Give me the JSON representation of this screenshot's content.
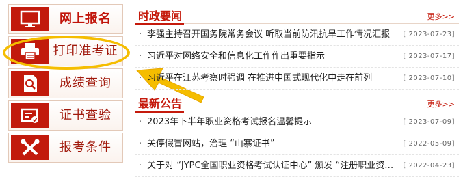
{
  "nav": {
    "items": [
      {
        "label": "网上报名",
        "icon": "monitor-icon"
      },
      {
        "label": "打印准考证",
        "icon": "printer-icon"
      },
      {
        "label": "成绩查询",
        "icon": "document-search-icon"
      },
      {
        "label": "证书查验",
        "icon": "certificate-check-icon"
      },
      {
        "label": "报考条件",
        "icon": "tools-icon"
      }
    ]
  },
  "politics": {
    "title": "时政要闻",
    "more": "更多>>",
    "items": [
      {
        "text": "李强主持召开国务院常务会议  听取当前防汛抗旱工作情况汇报",
        "date": "[ 2023-07-23]"
      },
      {
        "text": "习近平对网络安全和信息化工作作出重要指示",
        "date": "[ 2023-07-17]"
      },
      {
        "text": "习近平在江苏考察时强调  在推进中国式现代化中走在前列",
        "date": "[ 2023-07-10]"
      }
    ]
  },
  "notices": {
    "title": "最新公告",
    "more": "更多>>",
    "items": [
      {
        "text": "2023年下半年职业资格考试报名温馨提示",
        "date": "[ 2023-07-09]"
      },
      {
        "text": "关停假冒网站，治理 “山寨证书”",
        "date": "[ 2022-05-09]"
      },
      {
        "text": "关于对 “JYPC全国职业资格考试认证中心” 颁发 “注册职业资格证书” 的声明",
        "date": "[ 2022-04-23]"
      }
    ]
  },
  "colors": {
    "brand_red": "#c21a0c",
    "highlight_yellow": "#f5bd00"
  }
}
